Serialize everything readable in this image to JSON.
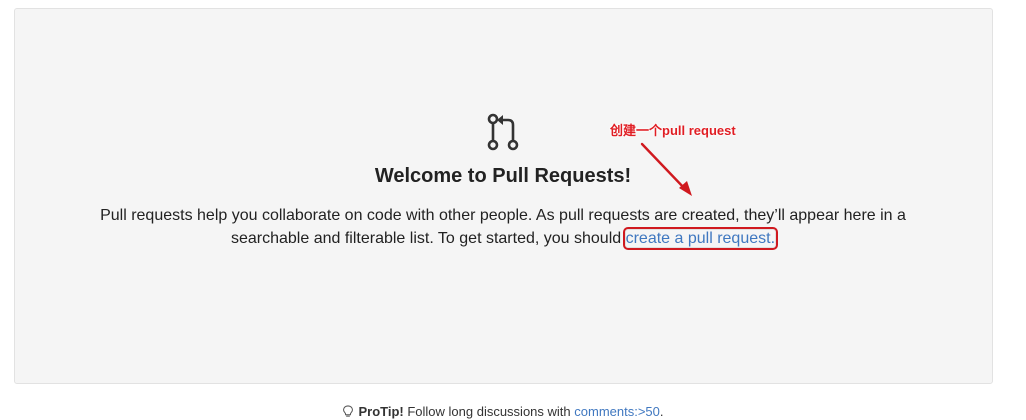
{
  "blankslate": {
    "icon": "git-pull-request-icon",
    "title": "Welcome to Pull Requests!",
    "description_line1": "Pull requests help you collaborate on code with other people. As pull requests are created, they’ll appear here in a",
    "description_line2": "searchable and filterable list. To get started, you should ",
    "link_text": "create a pull request."
  },
  "annotation": {
    "text": "创建一个pull request",
    "color": "#e01e24",
    "highlight_icon": "arrow-icon"
  },
  "protip": {
    "icon": "light-bulb-icon",
    "label": "ProTip!",
    "text": " Follow long discussions with ",
    "link_text": "comments:>50",
    "trailing": "."
  },
  "colors": {
    "link": "#4078c0",
    "panel_background": "#f5f5f5",
    "annotation_red": "#d0191f"
  }
}
